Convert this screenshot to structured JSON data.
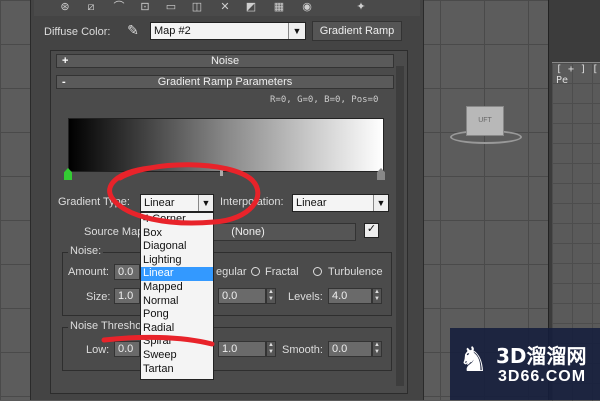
{
  "viewport": {
    "label": "[ + ] [ Pe",
    "object_label": "UFT",
    "axis_letter": "x"
  },
  "toolbar": {
    "icons": [
      "material-icon",
      "options-icon",
      "back-icon",
      "forward-icon",
      "layers-icon",
      "copy-icon",
      "paste-icon",
      "reset-icon",
      "checker-icon",
      "show-icon",
      "end-icon"
    ]
  },
  "diffuse": {
    "label": "Diffuse Color:",
    "map_value": "Map #2",
    "map_type_button": "Gradient Ramp"
  },
  "rollouts": {
    "noise": {
      "label": "Noise",
      "toggle": "+"
    },
    "gradient_ramp_params": {
      "label": "Gradient Ramp Parameters",
      "toggle": "-"
    }
  },
  "gradient": {
    "readout": "R=0, G=0, B=0,  Pos=0",
    "type_label": "Gradient Type:",
    "type_value": "Linear",
    "interpolation_label": "Interpolation:",
    "interpolation_value": "Linear",
    "type_options": [
      "4 Corner",
      "Box",
      "Diagonal",
      "Lighting",
      "Linear",
      "Mapped",
      "Normal",
      "Pong",
      "Radial",
      "Spiral",
      "Sweep",
      "Tartan"
    ],
    "selected_option": "Linear",
    "source_map_label": "Source Map",
    "source_map_value": "(None)",
    "source_map_enabled": "✓"
  },
  "noise_group": {
    "title": "Noise:",
    "amount_label": "Amount:",
    "amount_value": "0.0",
    "regular_label": "egular",
    "fractal_label": "Fractal",
    "turbulence_label": "Turbulence",
    "size_label": "Size:",
    "size_value": "1.0",
    "phase_value": "0.0",
    "levels_label": "Levels:",
    "levels_value": "4.0"
  },
  "threshold_group": {
    "title": "Noise Thresho",
    "low_label": "Low:",
    "low_value": "0.0",
    "high_value": "1.0",
    "smooth_label": "Smooth:",
    "smooth_value": "0.0"
  },
  "watermark": {
    "brand_cn": "3D溜溜网",
    "url": "3D66.COM"
  },
  "colors": {
    "selection": "#3399ff",
    "annotation": "#e8232a",
    "flag": "#33cc33"
  }
}
